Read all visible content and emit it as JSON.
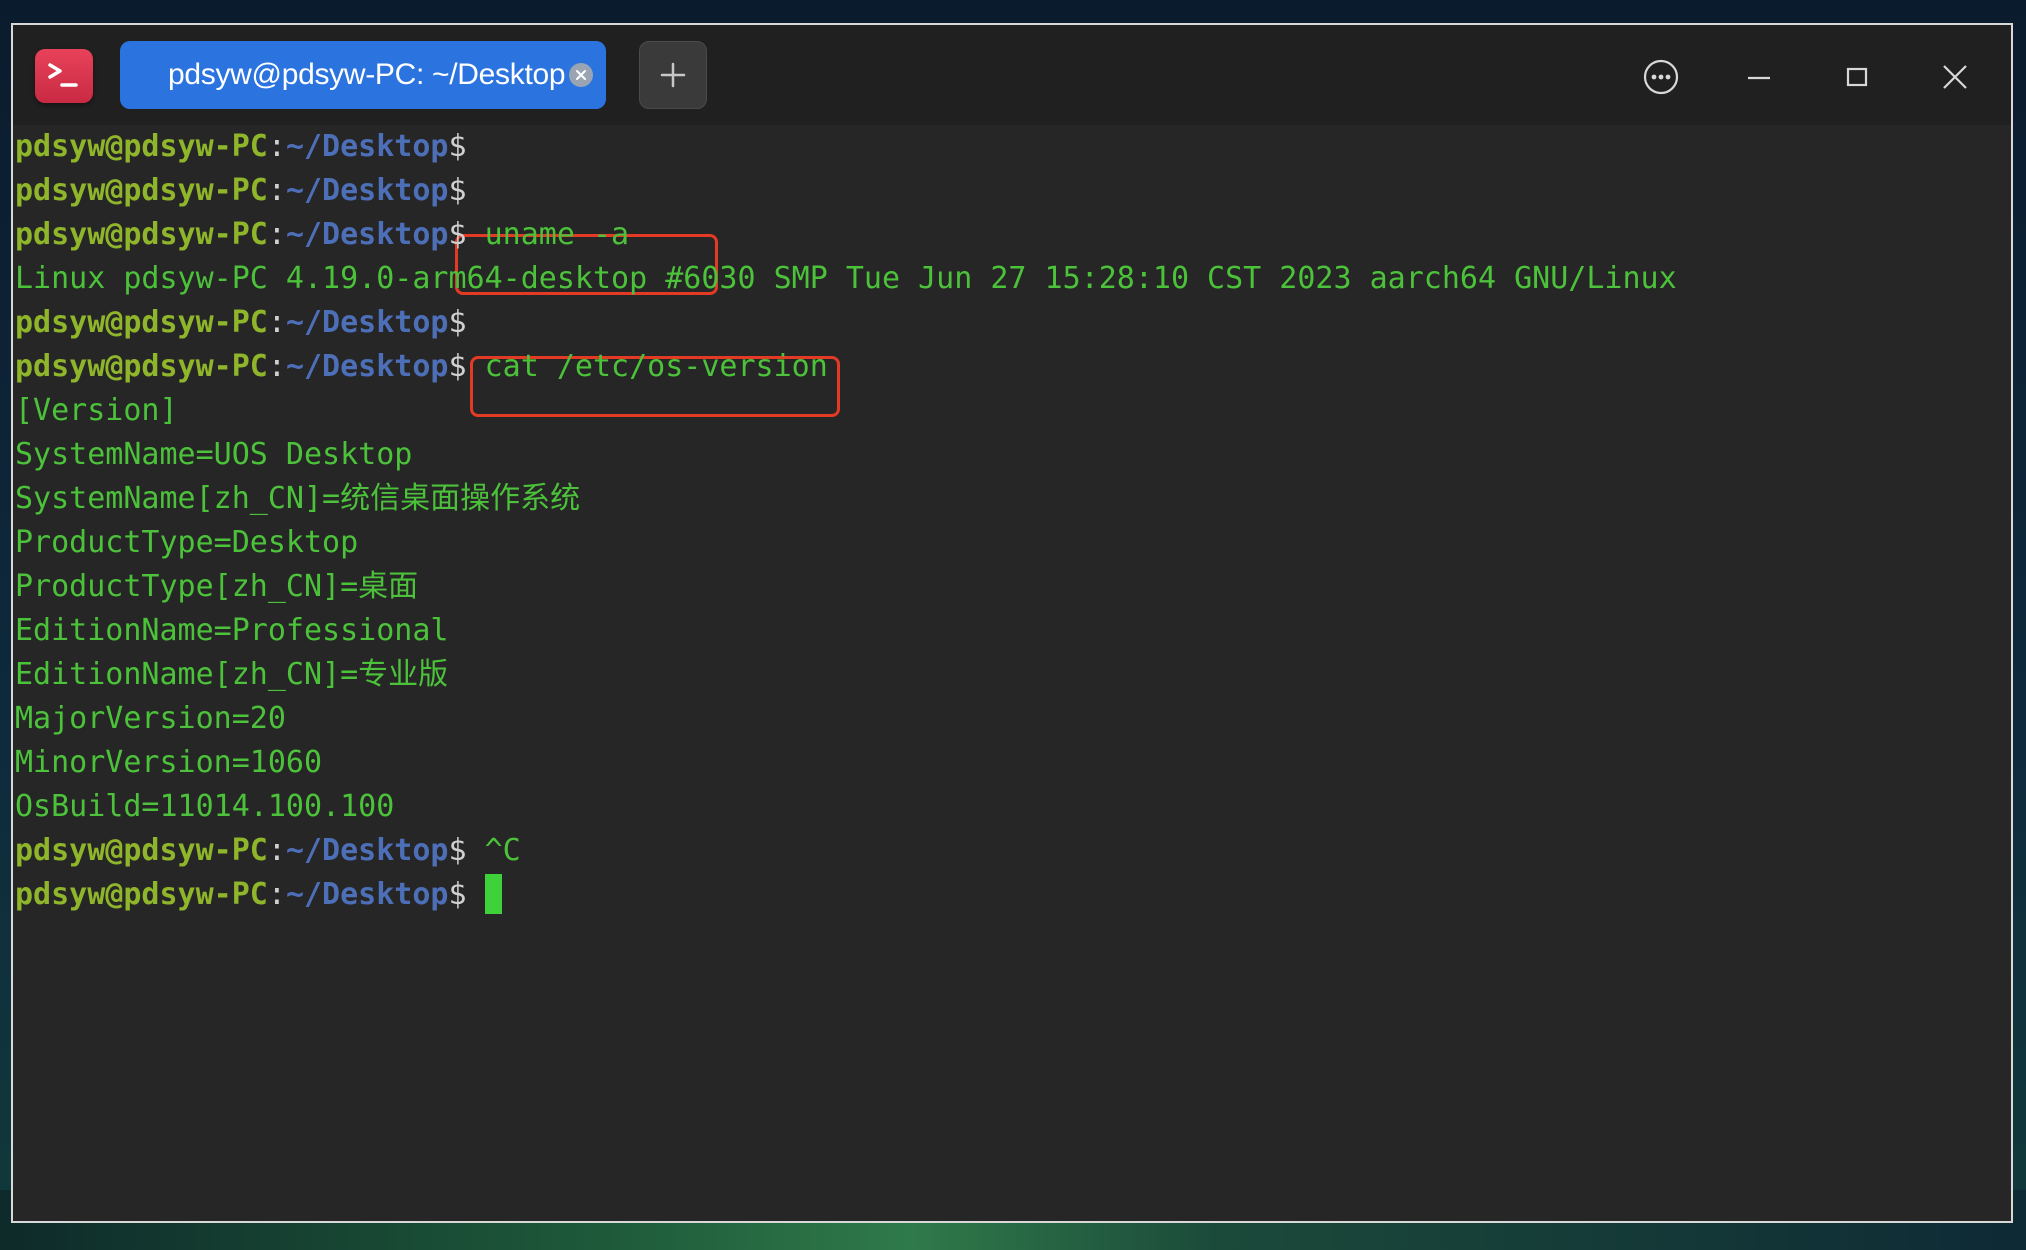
{
  "window": {
    "tab_title": "pdsyw@pdsyw-PC: ~/Desktop"
  },
  "prompt": {
    "user_host": "pdsyw@pdsyw-PC",
    "colon": ":",
    "path": "~/Desktop",
    "dollar": "$"
  },
  "terminal": {
    "lines": [
      {
        "type": "prompt",
        "cmd": ""
      },
      {
        "type": "prompt",
        "cmd": ""
      },
      {
        "type": "prompt",
        "cmd": " uname -a"
      },
      {
        "type": "output",
        "text": "Linux pdsyw-PC 4.19.0-arm64-desktop #6030 SMP Tue Jun 27 15:28:10 CST 2023 aarch64 GNU/Linux"
      },
      {
        "type": "prompt",
        "cmd": ""
      },
      {
        "type": "prompt",
        "cmd": " cat /etc/os-version"
      },
      {
        "type": "output",
        "text": "[Version]"
      },
      {
        "type": "output",
        "text": "SystemName=UOS Desktop"
      },
      {
        "type": "output",
        "text": "SystemName[zh_CN]=统信桌面操作系统"
      },
      {
        "type": "output",
        "text": "ProductType=Desktop"
      },
      {
        "type": "output",
        "text": "ProductType[zh_CN]=桌面"
      },
      {
        "type": "output",
        "text": "EditionName=Professional"
      },
      {
        "type": "output",
        "text": "EditionName[zh_CN]=专业版"
      },
      {
        "type": "output",
        "text": "MajorVersion=20"
      },
      {
        "type": "output",
        "text": "MinorVersion=1060"
      },
      {
        "type": "output",
        "text": "OsBuild=11014.100.100"
      },
      {
        "type": "prompt",
        "cmd": " ^C"
      },
      {
        "type": "prompt",
        "cmd": " ",
        "cursor": true
      }
    ]
  },
  "icons": {
    "app": "terminal-icon",
    "tab_close": "close-icon",
    "new_tab": "plus-icon",
    "menu": "more-icon",
    "minimize": "minimize-icon",
    "maximize": "maximize-icon",
    "close": "close-icon"
  },
  "colors": {
    "prompt_user": "#8fb52a",
    "prompt_path": "#4d6fb8",
    "text": "#4cc23a",
    "highlight": "#e23a24",
    "tab_active": "#2b74e0",
    "app_icon": "#d6364f"
  }
}
